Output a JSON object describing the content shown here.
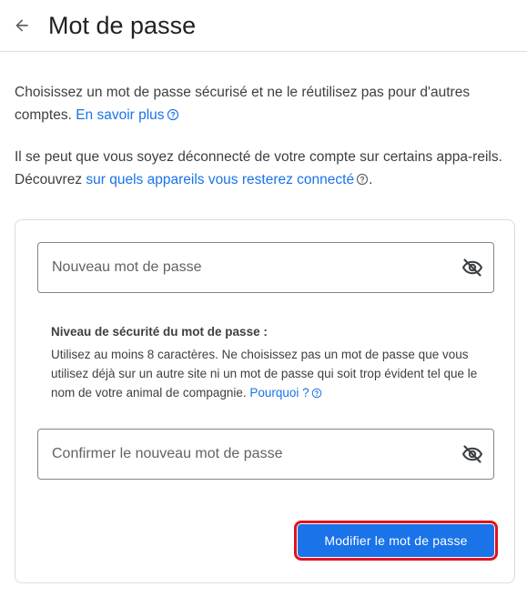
{
  "header": {
    "back_icon": "arrow-back-icon",
    "title": "Mot de passe"
  },
  "intro": {
    "p1_text": "Choisissez un mot de passe sécurisé et ne le réutilisez pas pour d'autres comptes.",
    "p1_link": "En savoir plus",
    "p2_text": "Il se peut que vous soyez déconnecté de votre compte sur certains appa-reils. Découvrez",
    "p2_link": "sur quels appareils vous resterez connecté",
    "p2_end": "."
  },
  "form": {
    "new_password": {
      "placeholder": "Nouveau mot de passe",
      "value": "",
      "icon": "visibility-off-icon"
    },
    "strength": {
      "heading": "Niveau de sécurité du mot de passe :",
      "description": "Utilisez au moins 8 caractères. Ne choisissez pas un mot de passe que vous utilisez déjà sur un autre site ni un mot de passe qui soit trop évident tel que le nom de votre animal de compagnie.",
      "link": "Pourquoi ?"
    },
    "confirm_password": {
      "placeholder": "Confirmer le nouveau mot de passe",
      "value": "",
      "icon": "visibility-off-icon"
    },
    "submit_label": "Modifier le mot de passe"
  },
  "colors": {
    "accent": "#1a73e8",
    "highlight_outline": "#e0131e",
    "text": "#202124",
    "secondary_text": "#3c4043",
    "border": "#dadce0"
  }
}
